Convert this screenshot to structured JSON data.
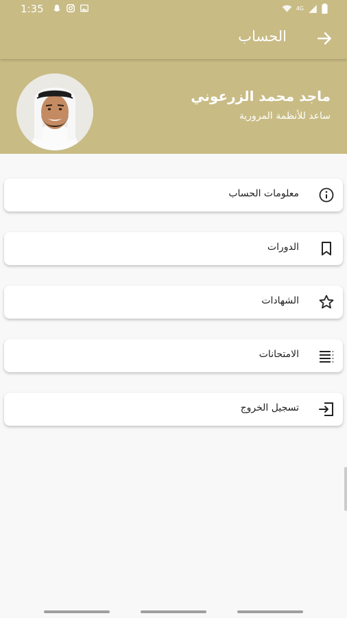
{
  "status_bar": {
    "time": "1:35",
    "left_icons": [
      "snapchat-icon",
      "instagram-icon",
      "image-icon"
    ],
    "right_icons": [
      "wifi-icon",
      "4g-icon",
      "signal-icon",
      "battery-icon"
    ],
    "network_label": "4G"
  },
  "app_bar": {
    "title": "الحساب",
    "back_icon": "arrow-right-icon"
  },
  "profile": {
    "name": "ماجد محمد الزرعوني",
    "role": "ساعد للأنظمة المرورية"
  },
  "menu": {
    "items": [
      {
        "label": "معلومات الحساب",
        "icon": "info-icon"
      },
      {
        "label": "الدورات",
        "icon": "bookmark-icon"
      },
      {
        "label": "الشهادات",
        "icon": "star-icon"
      },
      {
        "label": "الامتحانات",
        "icon": "list-icon"
      },
      {
        "label": "تسجيل الخروج",
        "icon": "logout-icon"
      }
    ]
  },
  "colors": {
    "primary": "#c8bb84",
    "background": "#f8f8f8",
    "card": "#ffffff",
    "text": "#222222"
  }
}
